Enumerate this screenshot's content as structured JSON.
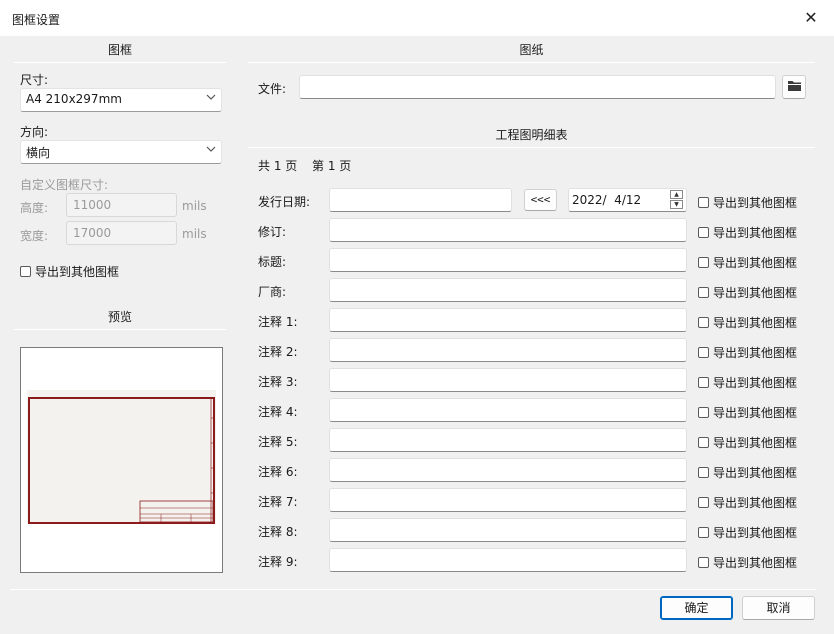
{
  "window": {
    "title": "图框设置",
    "close_glyph": "✕"
  },
  "left": {
    "frame_header": "图框",
    "size_label": "尺寸:",
    "size_value": "A4 210x297mm",
    "orientation_label": "方向:",
    "orientation_value": "横向",
    "custom_label": "自定义图框尺寸:",
    "height_label": "高度:",
    "height_value": "11000",
    "height_unit": "mils",
    "width_label": "宽度:",
    "width_value": "17000",
    "width_unit": "mils",
    "export_label": "导出到其他图框",
    "preview_header": "预览"
  },
  "right": {
    "sheet_header": "图纸",
    "file_label": "文件:",
    "file_value": "",
    "title_block_header": "工程图明细表",
    "page_info_total": "共 1 页",
    "page_info_current": "第 1 页",
    "date_label": "发行日期:",
    "date_value": "",
    "date_copy_button": "<<<",
    "date_picker_value": "2022/  4/12",
    "export_label": "导出到其他图框",
    "fields": [
      {
        "label": "修订:",
        "value": ""
      },
      {
        "label": "标题:",
        "value": ""
      },
      {
        "label": "厂商:",
        "value": ""
      },
      {
        "label": "注释 1:",
        "value": ""
      },
      {
        "label": "注释 2:",
        "value": ""
      },
      {
        "label": "注释 3:",
        "value": ""
      },
      {
        "label": "注释 4:",
        "value": ""
      },
      {
        "label": "注释 5:",
        "value": ""
      },
      {
        "label": "注释 6:",
        "value": ""
      },
      {
        "label": "注释 7:",
        "value": ""
      },
      {
        "label": "注释 8:",
        "value": ""
      },
      {
        "label": "注释 9:",
        "value": ""
      }
    ]
  },
  "footer": {
    "ok_label": "确定",
    "cancel_label": "取消"
  },
  "icons": {
    "folder": "folder-icon",
    "dropdown": "chevron-down-icon",
    "close": "close-icon"
  },
  "colors": {
    "frame_border": "#8b1a1a",
    "accent": "#0067c0"
  }
}
